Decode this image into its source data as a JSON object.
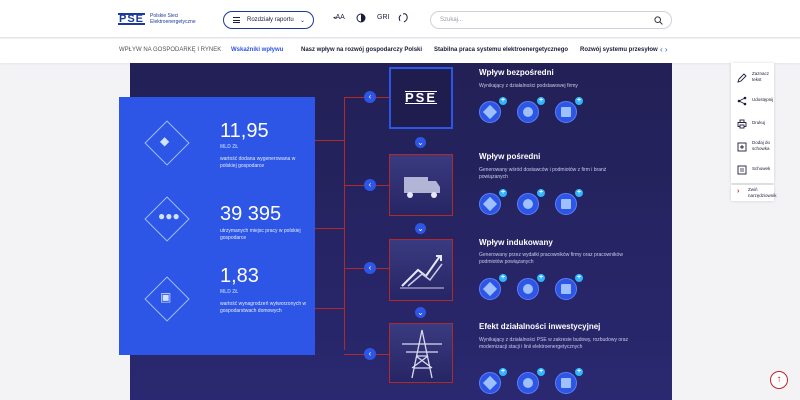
{
  "header": {
    "logo_mark": "PSE",
    "logo_text": "Polskie Sieci Elektroenergetyczne",
    "sections_label": "Rozdziały raportu",
    "font_size_label": "AA",
    "gri_label": "GRI",
    "search_placeholder": "Szukaj..."
  },
  "subnav": {
    "items": [
      "WPŁYW NA GOSPODARKĘ I RYNEK",
      "Wskaźniki wpływu",
      "Nasz wpływ na rozwój gospodarczy Polski",
      "Stabilna praca systemu elektroenergetycznego",
      "Rozwój systemu przesyłow"
    ],
    "arrows": "‹ ›"
  },
  "stats": [
    {
      "value": "11,95",
      "unit": "MLD ZŁ",
      "desc": "wartość dodana wygenerowana w polskiej gospodarce"
    },
    {
      "value": "39 395",
      "unit": "",
      "desc": "utrzymanych miejsc pracy w polskiej gospodarce"
    },
    {
      "value": "1,83",
      "unit": "MLD ZŁ",
      "desc": "wartość wynagrodzeń wytworzonych w gospodarstwach domowych"
    }
  ],
  "sections": [
    {
      "title": "Wpływ bezpośredni",
      "desc": "Wynikający z działalności podstawowej firmy"
    },
    {
      "title": "Wpływ pośredni",
      "desc": "Generowany wśród dostawców i podmiotów z firm i branż powiązanych"
    },
    {
      "title": "Wpływ indukowany",
      "desc": "Generowany przez wydatki pracowników firmy oraz pracowników podmiotów powiązanych"
    },
    {
      "title": "Efekt działalności inwestycyjnej",
      "desc": "Wynikający z działalności PSE w zakresie budowy, rozbudowy oraz modernizacji stacji i linii elektroenergetycznych"
    }
  ],
  "pse_box_label": "PSE",
  "sidebar": {
    "items": [
      "Zaznacz tekst",
      "Udostępnij",
      "Drukuj",
      "Dodaj do schowka",
      "Schowek"
    ],
    "hide_tools": "Zwiń narzędziownik"
  },
  "colors": {
    "accent": "#2d55e6",
    "brand": "#1b3a9a",
    "red": "#c0262d",
    "panel": "#222055"
  }
}
